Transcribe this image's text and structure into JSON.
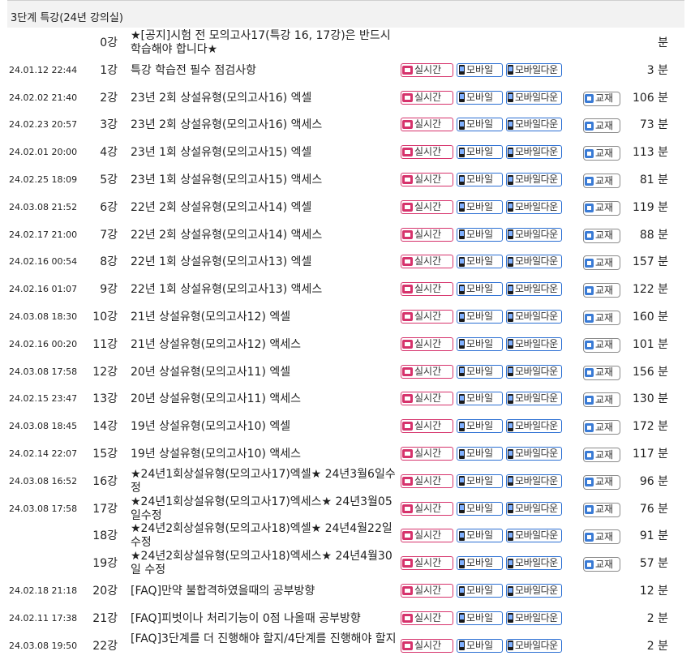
{
  "header": {
    "title": "3단계 특강(24년 강의실)"
  },
  "buttons": {
    "live": "실시간",
    "mobile": "모바일",
    "mobile_down": "모바일다운",
    "book": "교재"
  },
  "lectures": [
    {
      "date": "",
      "num": "0강",
      "title": "★[공지]시험 전 모의고사17(특강 16, 17강)은 반드시 학습해야 합니다★",
      "dur": "분",
      "media": false,
      "book": false
    },
    {
      "date": "24.01.12 22:44",
      "num": "1강",
      "title": "특강 학습전 필수 점검사항",
      "dur": "3 분",
      "media": true,
      "book": false
    },
    {
      "date": "24.02.02 21:40",
      "num": "2강",
      "title": "23년 2회 상설유형(모의고사16) 엑셀",
      "dur": "106 분",
      "media": true,
      "book": true
    },
    {
      "date": "24.02.23 20:57",
      "num": "3강",
      "title": "23년 2회 상설유형(모의고사16) 액세스",
      "dur": "73 분",
      "media": true,
      "book": true
    },
    {
      "date": "24.02.01 20:00",
      "num": "4강",
      "title": "23년 1회 상설유형(모의고사15) 엑셀",
      "dur": "113 분",
      "media": true,
      "book": true
    },
    {
      "date": "24.02.25 18:09",
      "num": "5강",
      "title": "23년 1회 상설유형(모의고사15) 액세스",
      "dur": "81 분",
      "media": true,
      "book": true
    },
    {
      "date": "24.03.08 21:52",
      "num": "6강",
      "title": "22년 2회 상설유형(모의고사14) 엑셀",
      "dur": "119 분",
      "media": true,
      "book": true
    },
    {
      "date": "24.02.17 21:00",
      "num": "7강",
      "title": "22년 2회 상설유형(모의고사14) 액세스",
      "dur": "88 분",
      "media": true,
      "book": true
    },
    {
      "date": "24.02.16 00:54",
      "num": "8강",
      "title": "22년 1회 상설유형(모의고사13) 엑셀",
      "dur": "157 분",
      "media": true,
      "book": true
    },
    {
      "date": "24.02.16 01:07",
      "num": "9강",
      "title": "22년 1회 상설유형(모의고사13) 액세스",
      "dur": "122 분",
      "media": true,
      "book": true
    },
    {
      "date": "24.03.08 18:30",
      "num": "10강",
      "title": "21년 상설유형(모의고사12) 엑셀",
      "dur": "160 분",
      "media": true,
      "book": true
    },
    {
      "date": "24.02.16 00:20",
      "num": "11강",
      "title": "21년 상설유형(모의고사12) 액세스",
      "dur": "101 분",
      "media": true,
      "book": true
    },
    {
      "date": "24.03.08 17:58",
      "num": "12강",
      "title": "20년 상설유형(모의고사11) 엑셀",
      "dur": "156 분",
      "media": true,
      "book": true
    },
    {
      "date": "24.02.15 23:47",
      "num": "13강",
      "title": "20년 상설유형(모의고사11) 액세스",
      "dur": "130 분",
      "media": true,
      "book": true
    },
    {
      "date": "24.03.08 18:45",
      "num": "14강",
      "title": "19년 상설유형(모의고사10) 엑셀",
      "dur": "172 분",
      "media": true,
      "book": true
    },
    {
      "date": "24.02.14 22:07",
      "num": "15강",
      "title": "19년 상설유형(모의고사10) 액세스",
      "dur": "117 분",
      "media": true,
      "book": true
    },
    {
      "date": "24.03.08 16:52",
      "num": "16강",
      "title": "★24년1회상설유형(모의고사17)엑셀★ 24년3월6일수정",
      "dur": "96 분",
      "media": true,
      "book": true
    },
    {
      "date": "24.03.08 17:58",
      "num": "17강",
      "title": "★24년1회상설유형(모의고사17)엑세스★ 24년3월05일수정",
      "dur": "76 분",
      "media": true,
      "book": true
    },
    {
      "date": "",
      "num": "18강",
      "title": "★24년2회상설유형(모의고사18)엑셀★ 24년4월22일수정",
      "dur": "91 분",
      "media": true,
      "book": true
    },
    {
      "date": "",
      "num": "19강",
      "title": "★24년2회상설유형(모의고사18)엑세스★ 24년4월30일 수정",
      "dur": "57 분",
      "media": true,
      "book": true
    },
    {
      "date": "24.02.18 21:18",
      "num": "20강",
      "title": "[FAQ]만약 불합격하였을때의 공부방향",
      "dur": "12 분",
      "media": true,
      "book": false
    },
    {
      "date": "24.02.11 17:38",
      "num": "21강",
      "title": "[FAQ]피벗이나 처리기능이 0점 나올때 공부방향",
      "dur": "2 분",
      "media": true,
      "book": false
    },
    {
      "date": "24.03.08 19:50",
      "num": "22강",
      "title": "[FAQ]3단계를 더 진행해야 할지/4단계를 진행해야 할지",
      "dur": "2 분",
      "media": true,
      "book": false
    }
  ]
}
